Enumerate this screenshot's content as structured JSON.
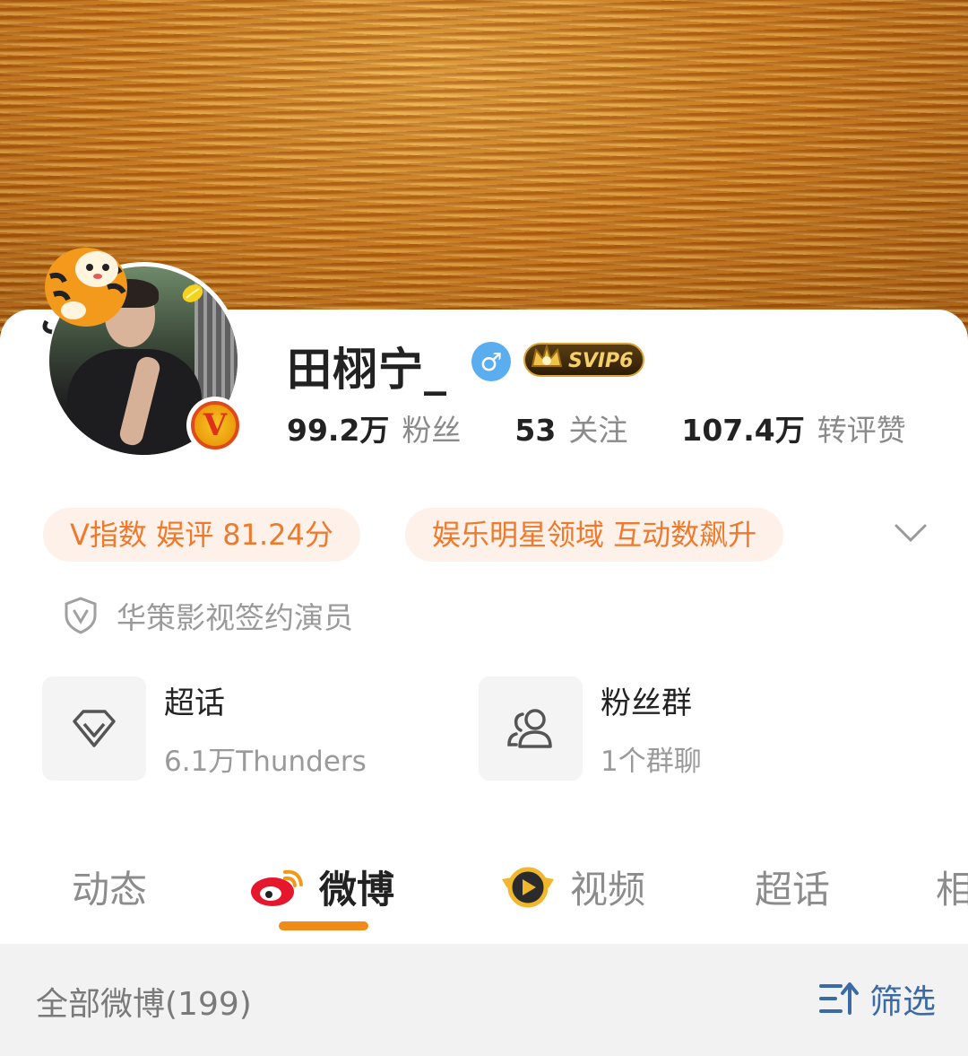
{
  "profile": {
    "name": "田栩宁_",
    "gender_symbol": "♂",
    "vip_badge": "SVIP6",
    "verified_badge": "V"
  },
  "stats": [
    {
      "num": "99.2万",
      "label": "粉丝"
    },
    {
      "num": "53",
      "label": "关注"
    },
    {
      "num": "107.4万",
      "label": "转评赞"
    }
  ],
  "chips": {
    "v_index": "V指数 娱评 81.24分",
    "domain": "娱乐明星领域 互动数飙升"
  },
  "verification": "华策影视签约演员",
  "entries": {
    "supertopic": {
      "title": "超话",
      "subtitle": "6.1万Thunders"
    },
    "fangroup": {
      "title": "粉丝群",
      "subtitle": "1个群聊"
    }
  },
  "tabs": [
    "动态",
    "微博",
    "视频",
    "超话",
    "相"
  ],
  "active_tab": "微博",
  "filter_bar": {
    "all_posts": "全部微博(199)",
    "filter_label": "筛选"
  },
  "colors": {
    "accent_orange": "#f0792b",
    "chip_bg": "#fdf1ea",
    "tab_underline": "#f28a17",
    "filter_blue": "#3b6ba7",
    "gender_blue": "#5aaef0"
  },
  "icons": [
    "tiger-sticker-icon",
    "lemon-icon",
    "v-verified-icon",
    "male-icon",
    "svip-crown-icon",
    "chevron-down-icon",
    "shield-v-icon",
    "diamond-icon",
    "people-icon",
    "weibo-logo-icon",
    "video-badge-icon",
    "sort-filter-icon"
  ]
}
